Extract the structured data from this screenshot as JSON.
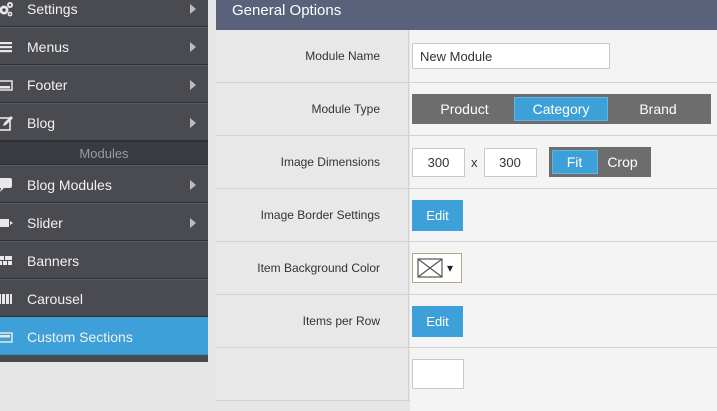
{
  "sidebar": {
    "items_top": [
      {
        "label": "Settings",
        "icon": "gears-icon"
      },
      {
        "label": "Menus",
        "icon": "menu-lines-icon"
      },
      {
        "label": "Footer",
        "icon": "footer-icon"
      },
      {
        "label": "Blog",
        "icon": "edit-icon"
      }
    ],
    "section_header": "Modules",
    "items_bottom": [
      {
        "label": "Blog Modules",
        "icon": "speech-bubble-icon"
      },
      {
        "label": "Slider",
        "icon": "slider-icon"
      },
      {
        "label": "Banners",
        "icon": "banners-grid-icon"
      },
      {
        "label": "Carousel",
        "icon": "carousel-icon"
      },
      {
        "label": "Custom Sections",
        "icon": "custom-sections-icon",
        "active": true
      }
    ]
  },
  "main": {
    "title": "General Options",
    "module_name": {
      "label": "Module Name",
      "value": "New Module"
    },
    "module_type": {
      "label": "Module Type",
      "options": [
        "Product",
        "Category",
        "Brand"
      ],
      "selected": "Category"
    },
    "image_dimensions": {
      "label": "Image Dimensions",
      "width": "300",
      "separator": "x",
      "height": "300",
      "modes": [
        "Fit",
        "Crop"
      ],
      "selected_mode": "Fit"
    },
    "image_border": {
      "label": "Image Border Settings",
      "button": "Edit"
    },
    "item_bg_color": {
      "label": "Item Background Color",
      "icon": "no-color-icon",
      "caret": "▾"
    },
    "items_per_row": {
      "label": "Items per Row",
      "button": "Edit"
    }
  },
  "colors": {
    "accent": "#3da0d8",
    "sidebar_bg": "#4a4b50",
    "header_bg": "#59627a"
  }
}
